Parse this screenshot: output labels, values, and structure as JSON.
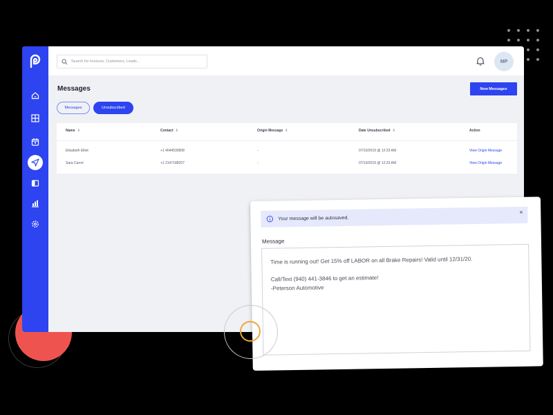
{
  "app": {
    "logo_icon": "brand-logo-icon",
    "accent_color": "#2d44f0"
  },
  "sidebar": {
    "items": [
      {
        "icon": "home-icon",
        "active": false
      },
      {
        "icon": "grid-icon",
        "active": false
      },
      {
        "icon": "calendar-icon",
        "active": false
      },
      {
        "icon": "send-icon",
        "active": true
      },
      {
        "icon": "contacts-icon",
        "active": false
      },
      {
        "icon": "chart-icon",
        "active": false
      },
      {
        "icon": "settings-icon",
        "active": false
      }
    ]
  },
  "header": {
    "search_placeholder": "Search for Invoices, Customers, Leads...",
    "avatar_initials": "MP"
  },
  "page": {
    "title": "Messages",
    "new_button_label": "New Messages",
    "tabs": [
      {
        "label": "Messages",
        "active": false
      },
      {
        "label": "Unsubscribed",
        "active": true
      }
    ]
  },
  "table": {
    "columns": [
      "Name",
      "Contact",
      "Origin Message",
      "Date Unsubscribed",
      "Action"
    ],
    "rows": [
      {
        "name": "Elisabeth Elliot",
        "contact": "+1 4044530808",
        "origin": "-",
        "date": "07/10/2019 @ 12:23 AM",
        "action": "View Origin Message"
      },
      {
        "name": "Sara Carrol",
        "contact": "+1 2147188207",
        "origin": "-",
        "date": "07/10/2019 @ 12:23 AM",
        "action": "View Origin Message"
      }
    ]
  },
  "popup": {
    "notice": "Your message will be autosaved.",
    "close_label": "×",
    "message_label": "Message",
    "message_lines": [
      "Time is running out! Get 15% off LABOR on all Brake Repairs! Valid until 12/31/20.",
      "",
      "Call/Text (940) 441-3846 to get an estimate!",
      "-Peterson Automotive"
    ]
  }
}
